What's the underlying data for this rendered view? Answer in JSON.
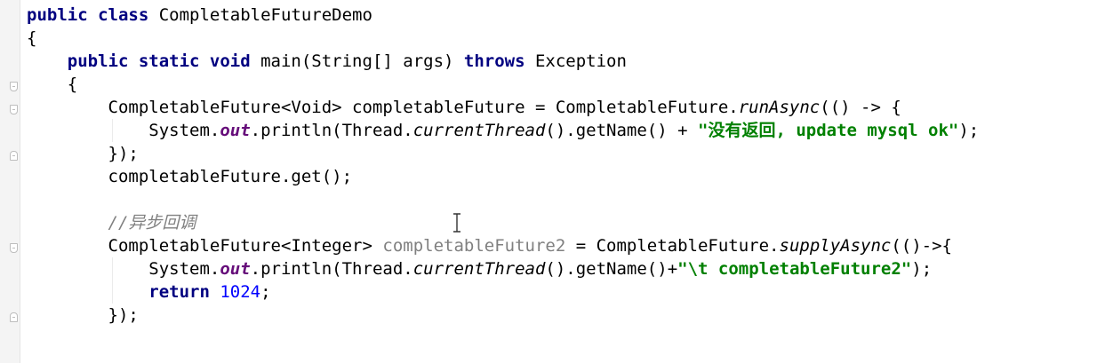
{
  "editor": {
    "lines": [
      [
        {
          "t": "public class ",
          "c": "kw"
        },
        {
          "t": "CompletableFutureDemo",
          "c": ""
        }
      ],
      [
        {
          "t": "{",
          "c": ""
        }
      ],
      [
        {
          "t": "    ",
          "c": ""
        },
        {
          "t": "public static void ",
          "c": "kw"
        },
        {
          "t": "main(String[] args) ",
          "c": ""
        },
        {
          "t": "throws ",
          "c": "kw"
        },
        {
          "t": "Exception",
          "c": ""
        }
      ],
      [
        {
          "t": "    {",
          "c": ""
        }
      ],
      [
        {
          "t": "        CompletableFuture<Void> completableFuture = CompletableFuture.",
          "c": ""
        },
        {
          "t": "runAsync",
          "c": "it"
        },
        {
          "t": "(() -> {",
          "c": ""
        }
      ],
      [
        {
          "t": "            System.",
          "c": ""
        },
        {
          "t": "out",
          "c": "fld"
        },
        {
          "t": ".println(Thread.",
          "c": ""
        },
        {
          "t": "currentThread",
          "c": "it"
        },
        {
          "t": "().getName() + ",
          "c": ""
        },
        {
          "t": "\"没有返回, update mysql ok\"",
          "c": "str"
        },
        {
          "t": ");",
          "c": ""
        }
      ],
      [
        {
          "t": "        });",
          "c": ""
        }
      ],
      [
        {
          "t": "        completableFuture.get();",
          "c": ""
        }
      ],
      [
        {
          "t": "",
          "c": ""
        }
      ],
      [
        {
          "t": "        //异步回调",
          "c": "cmt"
        }
      ],
      [
        {
          "t": "        CompletableFuture<Integer> ",
          "c": ""
        },
        {
          "t": "completableFuture2",
          "c": "unused"
        },
        {
          "t": " = CompletableFuture.",
          "c": ""
        },
        {
          "t": "supplyAsync",
          "c": "it"
        },
        {
          "t": "(()->{",
          "c": ""
        }
      ],
      [
        {
          "t": "            System.",
          "c": ""
        },
        {
          "t": "out",
          "c": "fld"
        },
        {
          "t": ".println(Thread.",
          "c": ""
        },
        {
          "t": "currentThread",
          "c": "it"
        },
        {
          "t": "().getName()+",
          "c": ""
        },
        {
          "t": "\"\\t completableFuture2\"",
          "c": "str"
        },
        {
          "t": ");",
          "c": ""
        }
      ],
      [
        {
          "t": "            ",
          "c": ""
        },
        {
          "t": "return ",
          "c": "kw"
        },
        {
          "t": "1024",
          "c": "num"
        },
        {
          "t": ";",
          "c": ""
        }
      ],
      [
        {
          "t": "        });",
          "c": ""
        }
      ]
    ]
  },
  "icons": {
    "fold_marker": "fold-icon",
    "text_cursor": "text-cursor-icon"
  },
  "colors": {
    "keyword": "#000080",
    "string": "#008000",
    "field": "#660e7a",
    "number": "#0000ff",
    "comment": "#808080",
    "gutter": "#f4f4f4"
  }
}
